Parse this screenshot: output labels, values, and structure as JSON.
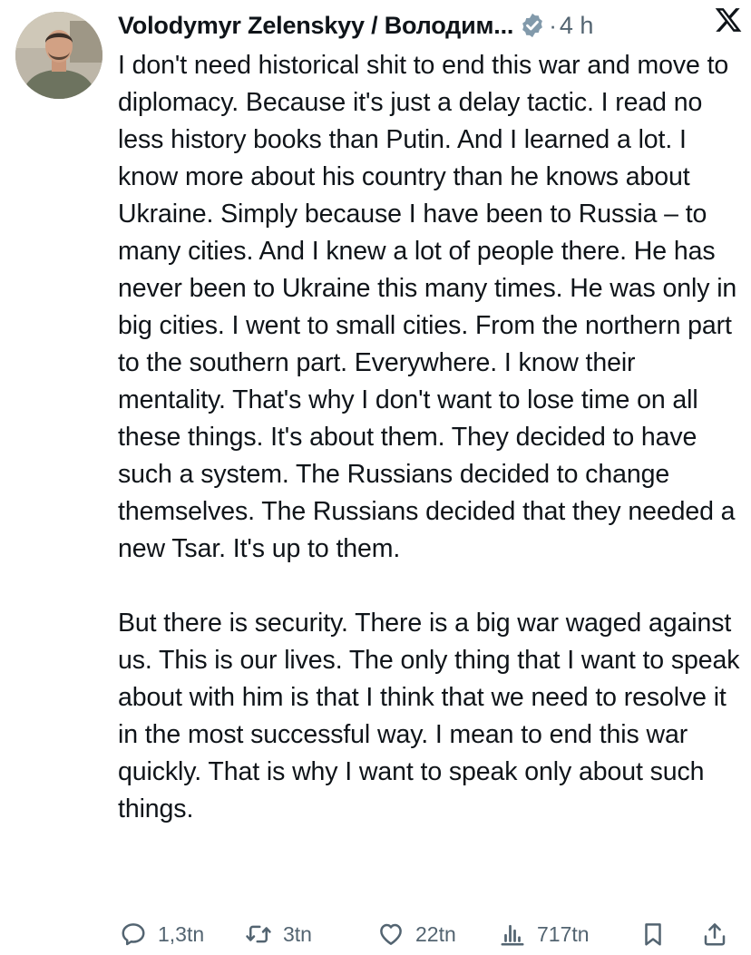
{
  "tweet": {
    "author_name": "Volodymyr Zelenskyy / Володим...",
    "separator": "·",
    "time": "4 h",
    "paragraphs": [
      "I don't need historical shit to end this war and move to diplomacy. Because it's just a delay tactic. I read no less history books than Putin. And I learned a lot. I know more about his country than he knows about Ukraine. Simply because I have been to Russia – to many cities. And I knew a lot of people there. He has never been to Ukraine this many times. He was only in big cities. I went to small cities. From the northern part to the southern part. Everywhere. I know their mentality. That's why I don't want to lose time on all these things. It's about them. They decided to have such a system. The Russians decided to change themselves. The Russians decided that they needed a new Tsar. It's up to them.",
      "But there is security. There is a big war waged against us. This is our lives. The only thing that I want to speak about with him is that I think that we need to resolve it in the most successful way. I mean to end this war quickly. That is why I want to speak only about such things."
    ]
  },
  "actions": {
    "replies": "1,3tn",
    "reposts": "3tn",
    "likes": "22tn",
    "views": "717tn"
  },
  "icons": {
    "verified": "verified-badge-icon",
    "logo": "x-logo-icon",
    "reply": "reply-icon",
    "repost": "repost-icon",
    "like": "heart-icon",
    "views": "views-icon",
    "bookmark": "bookmark-icon",
    "share": "share-icon"
  },
  "colors": {
    "text": "#0f1419",
    "secondary": "#536471",
    "verified_badge": "#829aab"
  }
}
